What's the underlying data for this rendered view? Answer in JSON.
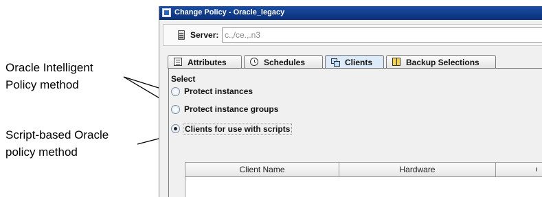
{
  "callouts": {
    "intelligent": {
      "line1": "Oracle Intelligent",
      "line2": "Policy method"
    },
    "script_based": {
      "line1": "Script-based Oracle",
      "line2": "policy method"
    }
  },
  "window": {
    "title": "Change Policy - Oracle_legacy",
    "server_label": "Server:",
    "server_value": "c.,/ce.,.n3"
  },
  "tabs": [
    {
      "label": "Attributes",
      "icon": "document-list-icon",
      "active": false
    },
    {
      "label": "Schedules",
      "icon": "clock-icon",
      "active": false
    },
    {
      "label": "Clients",
      "icon": "computers-icon",
      "active": true
    },
    {
      "label": "Backup Selections",
      "icon": "book-icon",
      "active": false
    }
  ],
  "clients_panel": {
    "select_label": "Select",
    "options": [
      {
        "label": "Protect instances",
        "selected": false
      },
      {
        "label": "Protect instance groups",
        "selected": false
      },
      {
        "label": "Clients for use with scripts",
        "selected": true
      }
    ],
    "table_headers": [
      "Client Name",
      "Hardware",
      "C"
    ]
  },
  "colors": {
    "titlebar": "#1b4ea6",
    "active_tab": "#dcebf7",
    "panel_bg": "#f0f0f0"
  }
}
